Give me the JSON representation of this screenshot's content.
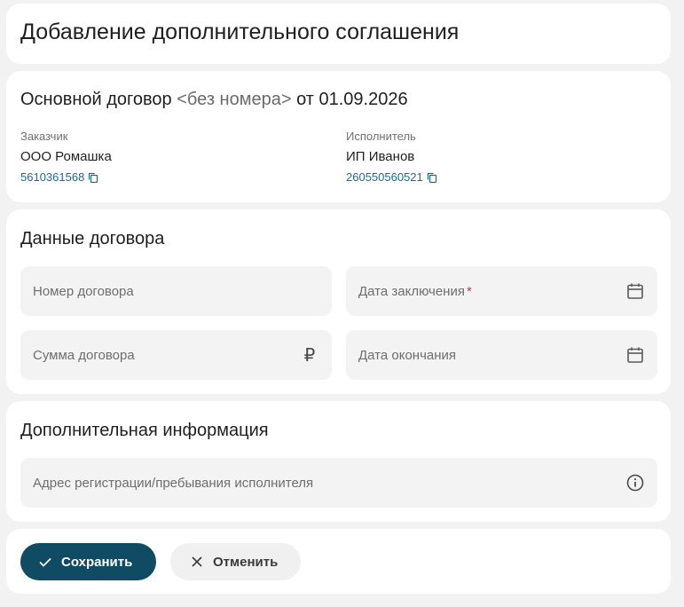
{
  "page": {
    "title": "Добавление дополнительного соглашения"
  },
  "main_contract": {
    "heading_prefix": "Основной договор",
    "number_placeholder": "<без номера>",
    "date_prefix": "от",
    "date": "01.09.2026",
    "customer": {
      "label": "Заказчик",
      "name": "ООО Ромашка",
      "inn": "5610361568"
    },
    "contractor": {
      "label": "Исполнитель",
      "name": "ИП Иванов",
      "inn": "260550560521"
    }
  },
  "contract_data": {
    "heading": "Данные договора",
    "fields": {
      "number": {
        "placeholder": "Номер договора"
      },
      "date_signed": {
        "placeholder": "Дата заключения",
        "required_mark": "*"
      },
      "amount": {
        "placeholder": "Сумма договора",
        "currency_symbol": "₽"
      },
      "date_end": {
        "placeholder": "Дата окончания"
      }
    }
  },
  "additional_info": {
    "heading": "Дополнительная информация",
    "address": {
      "placeholder": "Адрес регистрации/пребывания исполнителя"
    }
  },
  "actions": {
    "save_label": "Сохранить",
    "cancel_label": "Отменить"
  },
  "colors": {
    "primary": "#0f4c64",
    "link": "#1b6b8f",
    "required": "#c0392b"
  }
}
